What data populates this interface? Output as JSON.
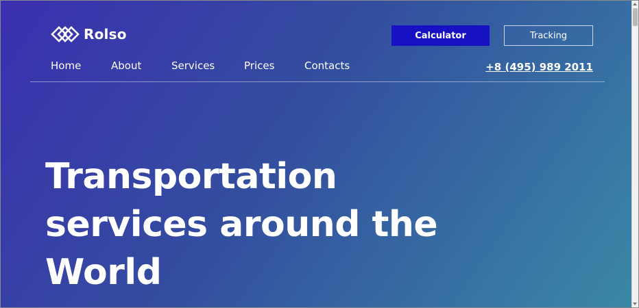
{
  "brand": {
    "name": "Rolso",
    "logo_icon": "diamond-chain-logo-icon"
  },
  "header": {
    "calculator_label": "Calculator",
    "tracking_label": "Tracking",
    "phone": "+8 (495) 989 2011"
  },
  "nav": {
    "items": [
      {
        "label": "Home"
      },
      {
        "label": "About"
      },
      {
        "label": "Services"
      },
      {
        "label": "Prices"
      },
      {
        "label": "Contacts"
      }
    ]
  },
  "hero": {
    "headline_lines": [
      "Transportation",
      "services around the",
      "World"
    ]
  },
  "colors": {
    "gradient_start": "#3b2fb0",
    "gradient_end": "#3a88a6",
    "calculator_button": "#1612c4",
    "text": "#ffffff"
  }
}
